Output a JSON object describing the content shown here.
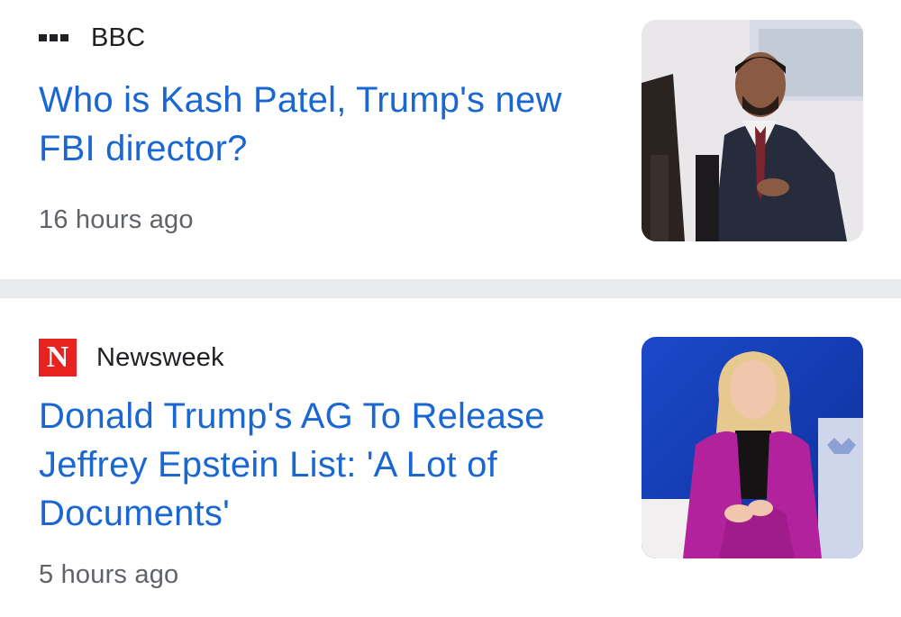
{
  "articles": [
    {
      "source": "BBC",
      "source_logo": "bbc-logo",
      "headline_lines": [
        "Who is Kash Patel, Trump's new",
        "FBI director?"
      ],
      "time": "16 hours ago",
      "thumbnail": "man-in-suit-photo"
    },
    {
      "source": "Newsweek",
      "source_logo": "newsweek-logo",
      "logo_letter": "N",
      "headline_lines": [
        "Donald Trump's AG To Release",
        "Jeffrey Epstein List: 'A Lot of",
        "Documents'"
      ],
      "time": "5 hours ago",
      "thumbnail": "woman-in-magenta-suit-photo"
    }
  ],
  "colors": {
    "headline": "#1a67d2",
    "time": "#5f6368",
    "source": "#202124",
    "divider": "#e8eaed",
    "newsweek_red": "#e8231f"
  }
}
